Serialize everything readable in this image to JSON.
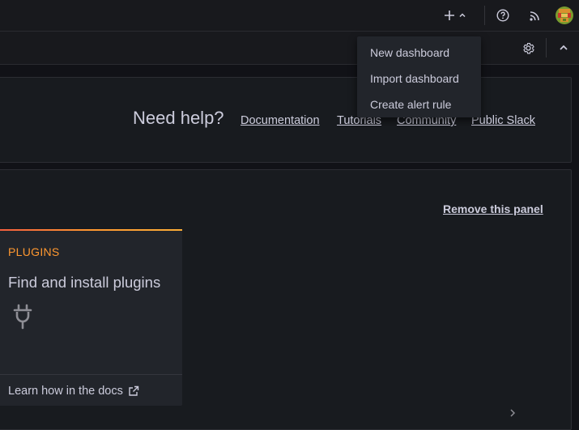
{
  "topbar": {
    "add_icon": "plus-icon",
    "add_chevron_icon": "chevron-up-icon",
    "help_icon": "question-circle-icon",
    "news_icon": "rss-icon",
    "avatar": "user-avatar"
  },
  "toolbar": {
    "settings_icon": "gear-icon",
    "collapse_icon": "chevron-up-icon"
  },
  "add_menu": {
    "items": [
      {
        "label": "New dashboard"
      },
      {
        "label": "Import dashboard"
      },
      {
        "label": "Create alert rule"
      }
    ]
  },
  "help_panel": {
    "title": "Need help?",
    "links": [
      {
        "label": "Documentation"
      },
      {
        "label": "Tutorials"
      },
      {
        "label": "Community"
      },
      {
        "label": "Public Slack"
      }
    ]
  },
  "getting_started": {
    "remove_label": "Remove this panel",
    "card": {
      "label": "PLUGINS",
      "title": "Find and install plugins",
      "icon": "plug-icon",
      "footer_link": "Learn how in the docs",
      "footer_icon": "external-link-icon"
    }
  },
  "colors": {
    "background": "#111217",
    "panel": "#181b1f",
    "card": "#22252b",
    "accent": "#ff9830",
    "text": "#ccccdc"
  }
}
